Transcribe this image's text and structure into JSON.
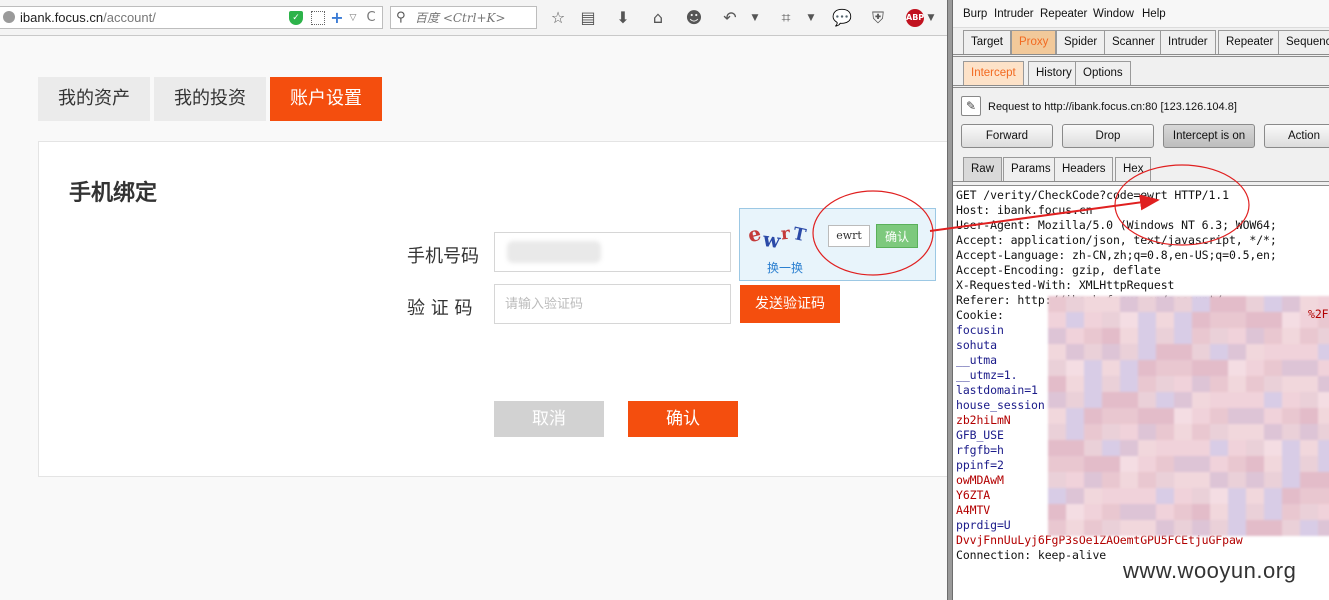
{
  "browser": {
    "url_host": "ibank.focus.cn",
    "url_path": "/account/",
    "search_placeholder": "百度 <Ctrl+K>",
    "abp_label": "ABP"
  },
  "page": {
    "tabs": [
      {
        "label": "我的资产",
        "active": false
      },
      {
        "label": "我的投资",
        "active": false
      },
      {
        "label": "账户设置",
        "active": true
      }
    ],
    "section_title": "手机绑定",
    "phone_label": "手机号码",
    "code_label": "验 证 码",
    "code_placeholder": "请输入验证码",
    "send_code_button": "发送验证码",
    "cancel_button": "取消",
    "confirm_button": "确认",
    "captcha": {
      "chars": [
        "e",
        "w",
        "r",
        "T"
      ],
      "input_value": "ewrt",
      "ok_button": "确认",
      "refresh_link": "换一换"
    }
  },
  "burp": {
    "menu": [
      "Burp",
      "Intruder",
      "Repeater",
      "Window",
      "Help"
    ],
    "main_tabs": [
      "Target",
      "Proxy",
      "Spider",
      "Scanner",
      "Intruder",
      "Repeater",
      "Sequencer"
    ],
    "active_main_tab": "Proxy",
    "proxy_tabs": [
      "Intercept",
      "History",
      "Options"
    ],
    "active_proxy_tab": "Intercept",
    "request_info": "Request to http://ibank.focus.cn:80  [123.126.104.8]",
    "buttons": {
      "forward": "Forward",
      "drop": "Drop",
      "intercept": "Intercept is on",
      "action": "Action"
    },
    "view_tabs": [
      "Raw",
      "Params",
      "Headers",
      "Hex"
    ],
    "active_view_tab": "Raw",
    "request_lines": [
      {
        "text": "GET /verity/CheckCode?code=ewrt HTTP/1.1",
        "color": "black"
      },
      {
        "text": "Host: ibank.focus.cn",
        "color": "black"
      },
      {
        "text": "User-Agent: Mozilla/5.0 (Windows NT 6.3; WOW64;",
        "color": "black"
      },
      {
        "text": "Accept: application/json, text/javascript, */*;",
        "color": "black"
      },
      {
        "text": "Accept-Language: zh-CN,zh;q=0.8,en-US;q=0.5,en;",
        "color": "black"
      },
      {
        "text": "Accept-Encoding: gzip, deflate",
        "color": "black"
      },
      {
        "text": "X-Requested-With: XMLHttpRequest",
        "color": "black"
      },
      {
        "text": "Referer: http://ibank.focus.cn/account/",
        "color": "black"
      },
      {
        "text": "Cookie:",
        "color": "black",
        "tail": "%2F"
      },
      {
        "text": "focusin",
        "color": "blue"
      },
      {
        "text": "sohuta",
        "color": "blue"
      },
      {
        "text": "__utma",
        "color": "blue"
      },
      {
        "text": "__utmz=1.",
        "color": "blue"
      },
      {
        "text": "lastdomain=1",
        "color": "blue"
      },
      {
        "text": "house_session",
        "color": "blue"
      },
      {
        "text": "zb2hiLmN",
        "color": "red"
      },
      {
        "text": "GFB_USE",
        "color": "blue"
      },
      {
        "text": "rfgfb=h",
        "color": "blue"
      },
      {
        "text": "ppinf=2",
        "color": "blue"
      },
      {
        "text": "owMDAwM",
        "color": "red"
      },
      {
        "text": "Y6ZTA",
        "color": "red"
      },
      {
        "text": "A4MTV",
        "color": "red"
      },
      {
        "text": "pprdig=U",
        "color": "blue"
      },
      {
        "text": "DvvjFnnUuLyj6FgP3sOe1ZAOemtGPU5FCEtjuGFpaw",
        "color": "red"
      },
      {
        "text": "Connection: keep-alive",
        "color": "black"
      }
    ],
    "watermark": "www.wooyun.org"
  }
}
